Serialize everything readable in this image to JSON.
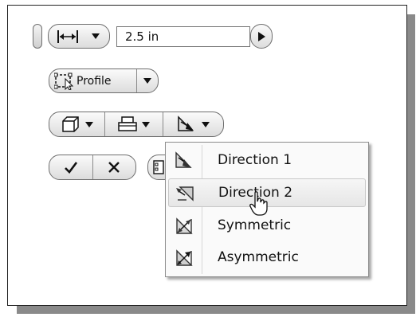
{
  "distance": {
    "value": "2.5 in"
  },
  "profile_button": {
    "label": "Profile"
  },
  "menu": {
    "items": [
      {
        "label": "Direction 1"
      },
      {
        "label": "Direction 2"
      },
      {
        "label": "Symmetric"
      },
      {
        "label": "Asymmetric"
      }
    ]
  },
  "colors": {
    "frame": "#222222",
    "shadow": "#8a8a8a",
    "hover": "#e8e8e8"
  }
}
